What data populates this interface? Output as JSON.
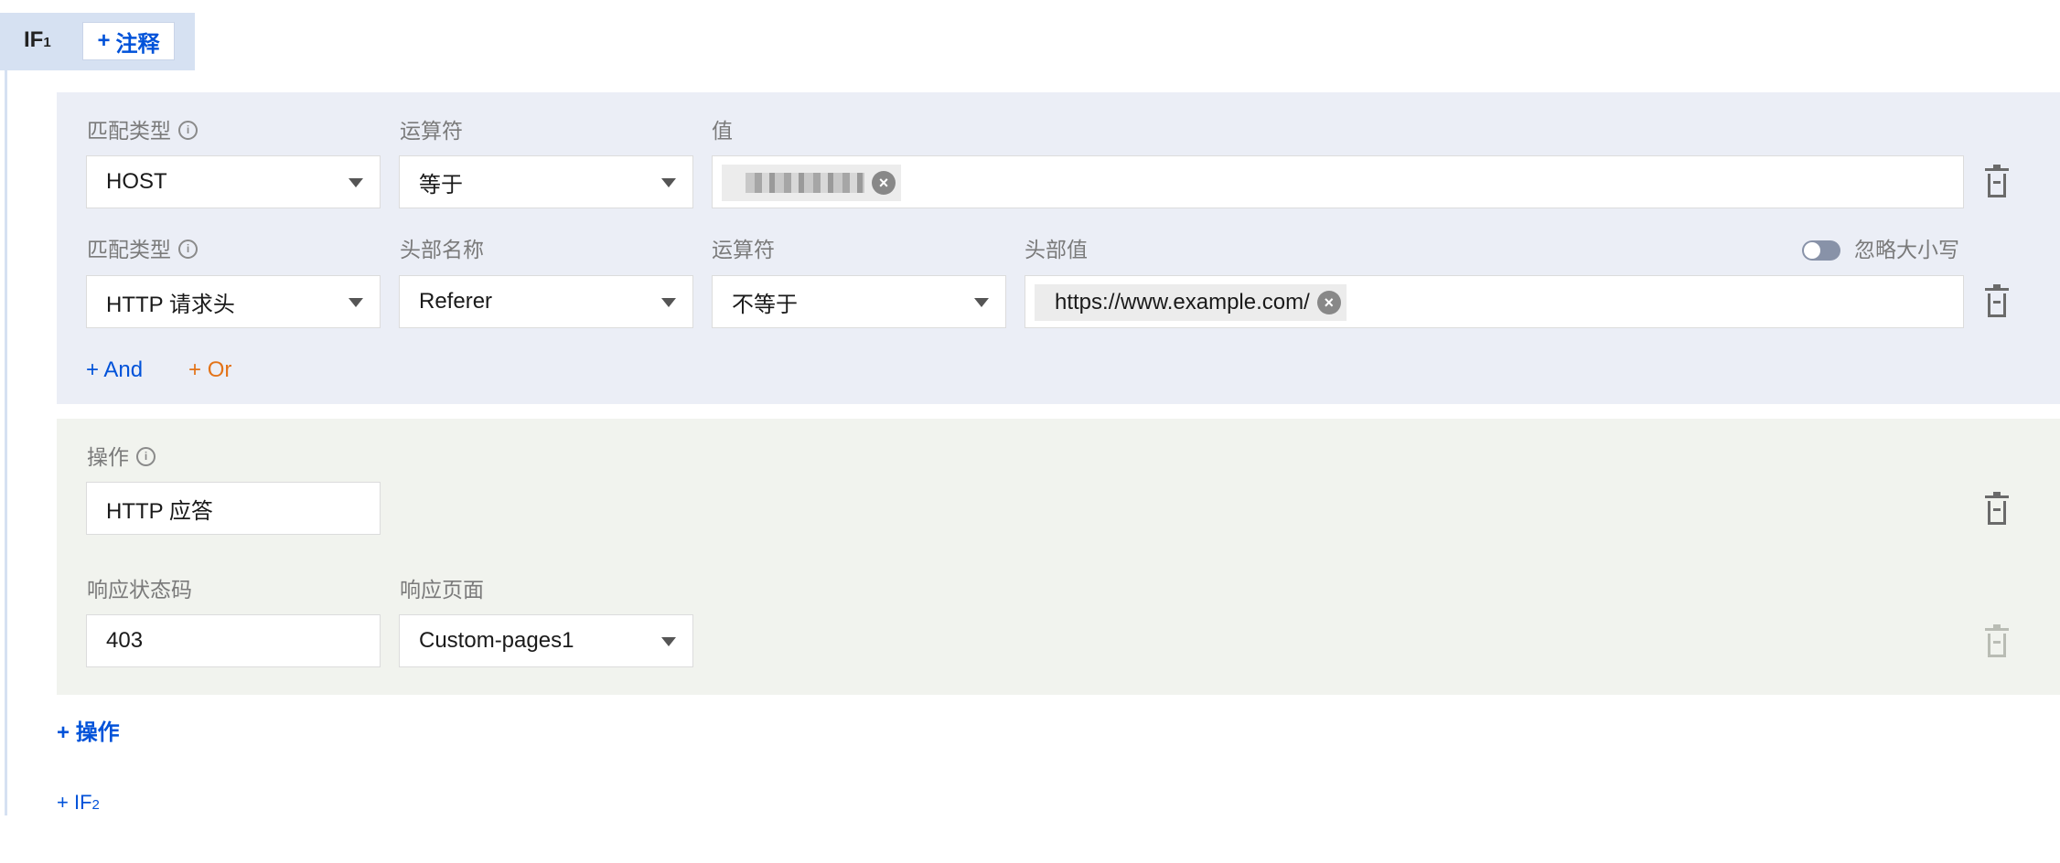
{
  "rule": {
    "if_label": "IF",
    "if_index": "1",
    "add_note_label": "注释"
  },
  "conditions": {
    "row1": {
      "match_type_label": "匹配类型",
      "match_type_value": "HOST",
      "operator_label": "运算符",
      "operator_value": "等于",
      "value_label": "值"
    },
    "row2": {
      "match_type_label": "匹配类型",
      "match_type_value": "HTTP 请求头",
      "header_name_label": "头部名称",
      "header_name_value": "Referer",
      "operator_label": "运算符",
      "operator_value": "不等于",
      "header_value_label": "头部值",
      "header_value_tag": "https://www.example.com/",
      "ignore_case_label": "忽略大小写",
      "ignore_case_enabled": false
    },
    "add_and_label": "And",
    "add_or_label": "Or"
  },
  "operations": {
    "operation_label": "操作",
    "operation_value": "HTTP 应答",
    "status_code_label": "响应状态码",
    "status_code_value": "403",
    "response_page_label": "响应页面",
    "response_page_value": "Custom-pages1",
    "add_operation_label": "操作"
  },
  "add_if": {
    "label": "IF",
    "index": "2"
  },
  "icons": {
    "info": "info-circle-icon",
    "caret": "caret-down-icon",
    "clear": "close-circle-icon",
    "delete": "trash-icon",
    "plus": "plus-icon"
  },
  "colors": {
    "accent_blue": "#0052d9",
    "accent_orange": "#e37318",
    "condition_bg": "#ebeef6",
    "operation_bg": "#f1f3ee"
  }
}
